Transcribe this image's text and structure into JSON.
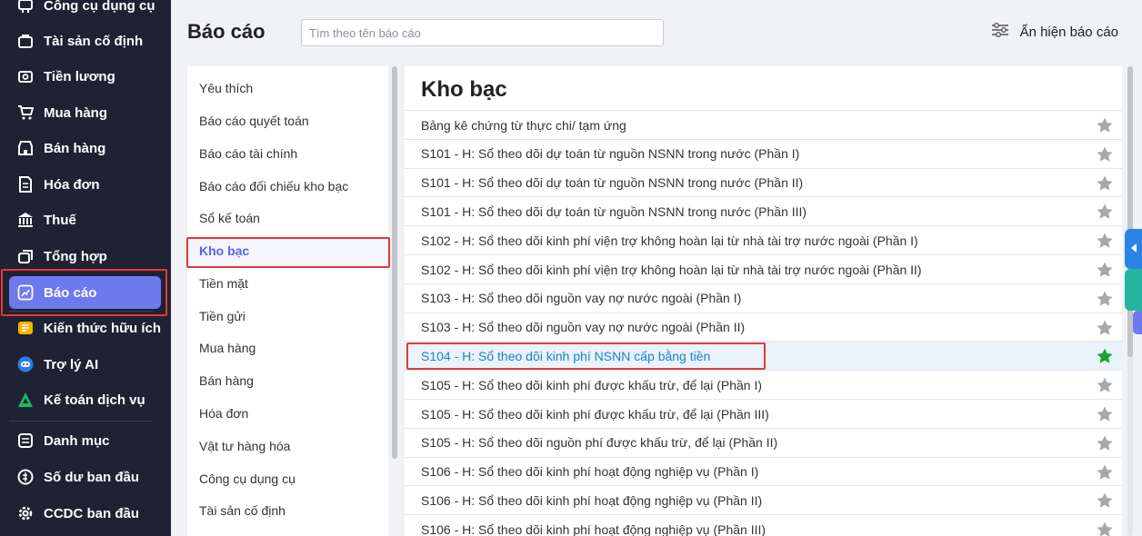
{
  "sidebar": {
    "items": [
      {
        "label": "Công cụ dụng cụ",
        "icon": "tools-icon"
      },
      {
        "label": "Tài sản cố định",
        "icon": "briefcase-icon"
      },
      {
        "label": "Tiền lương",
        "icon": "salary-icon"
      },
      {
        "label": "Mua hàng",
        "icon": "cart-icon"
      },
      {
        "label": "Bán hàng",
        "icon": "shop-icon"
      },
      {
        "label": "Hóa đơn",
        "icon": "invoice-icon"
      },
      {
        "label": "Thuế",
        "icon": "bank-icon"
      },
      {
        "label": "Tổng hợp",
        "icon": "layers-icon"
      },
      {
        "label": "Báo cáo",
        "icon": "report-chart-icon"
      },
      {
        "label": "Kiến thức hữu ích",
        "icon": "knowledge-icon"
      },
      {
        "label": "Trợ lý AI",
        "icon": "ai-bot-icon"
      },
      {
        "label": "Kế toán dịch vụ",
        "icon": "service-icon"
      },
      {
        "label": "Danh mục",
        "icon": "catalog-icon"
      },
      {
        "label": "Số dư ban đầu",
        "icon": "balance-icon"
      },
      {
        "label": "CCDC ban đầu",
        "icon": "settings-icon"
      }
    ]
  },
  "header": {
    "title": "Báo cáo",
    "search_placeholder": "Tìm theo tên báo cáo",
    "toggle_label": "Ẩn hiện báo cáo"
  },
  "categories": [
    "Yêu thích",
    "Báo cáo quyết toán",
    "Báo cáo tài chính",
    "Báo cáo đối chiếu kho bạc",
    "Sổ kế toán",
    "Kho bạc",
    "Tiền mặt",
    "Tiền gửi",
    "Mua hàng",
    "Bán hàng",
    "Hóa đơn",
    "Vật tư hàng hóa",
    "Công cụ dụng cụ",
    "Tài sản cố định"
  ],
  "reports": {
    "title": "Kho bạc",
    "items": [
      {
        "label": "Bảng kê chứng từ thực chi/ tạm ứng",
        "favorite": false
      },
      {
        "label": "S101 - H: Sổ theo dõi dự toán từ nguồn NSNN trong nước (Phần I)",
        "favorite": false
      },
      {
        "label": "S101 - H: Sổ theo dõi dự toán từ nguồn NSNN trong nước (Phần II)",
        "favorite": false
      },
      {
        "label": "S101 - H: Sổ theo dõi dự toán từ nguồn NSNN trong nước (Phần III)",
        "favorite": false
      },
      {
        "label": "S102 - H: Sổ theo dõi kinh phí viện trợ không hoàn lại từ nhà tài trợ nước ngoài (Phần I)",
        "favorite": false
      },
      {
        "label": "S102 - H: Sổ theo dõi kinh phí viện trợ không hoàn lại từ nhà tài trợ nước ngoài (Phần II)",
        "favorite": false
      },
      {
        "label": "S103 - H: Sổ theo dõi nguồn vay nợ nước ngoài (Phần I)",
        "favorite": false
      },
      {
        "label": "S103 - H: Sổ theo dõi nguồn vay nợ nước ngoài (Phần II)",
        "favorite": false
      },
      {
        "label": "S104 - H: Sổ theo dõi kinh phí NSNN cấp bằng tiền",
        "favorite": true
      },
      {
        "label": "S105 - H: Sổ theo dõi kinh phí được khấu trừ, để lại (Phần I)",
        "favorite": false
      },
      {
        "label": "S105 - H: Sổ theo dõi kinh phí được khấu trừ, để lại (Phần III)",
        "favorite": false
      },
      {
        "label": "S105 - H: Sổ theo dõi nguồn phí được khấu trừ, để lại (Phần II)",
        "favorite": false
      },
      {
        "label": "S106 - H: Sổ theo dõi kinh phí hoạt động nghiệp vụ (Phần I)",
        "favorite": false
      },
      {
        "label": "S106 - H: Sổ theo dõi kinh phí hoạt động nghiệp vụ (Phần II)",
        "favorite": false
      },
      {
        "label": "S106 - H: Sổ theo dõi kinh phí hoạt động nghiệp vụ (Phần III)",
        "favorite": false
      }
    ]
  },
  "colors": {
    "sidebar_bg": "#1e2233",
    "active_nav": "#6f79ee",
    "highlight_red": "#e53935",
    "star_grey": "#a5a8ad",
    "star_green": "#1aa33a",
    "selected_text": "#1e7fd1"
  }
}
